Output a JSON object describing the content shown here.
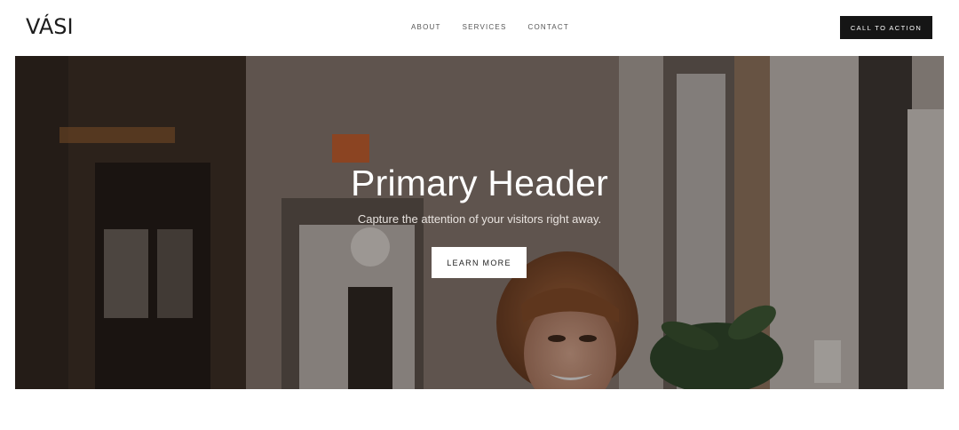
{
  "header": {
    "logo": "VÁSI",
    "nav": [
      "ABOUT",
      "SERVICES",
      "CONTACT"
    ],
    "cta_label": "CALL TO ACTION"
  },
  "hero": {
    "title": "Primary Header",
    "subtitle": "Capture the attention of your visitors right away.",
    "button_label": "LEARN MORE"
  },
  "colors": {
    "cta_bg": "#151515",
    "hero_overlay": "#3a332e",
    "button_bg": "#ffffff"
  }
}
